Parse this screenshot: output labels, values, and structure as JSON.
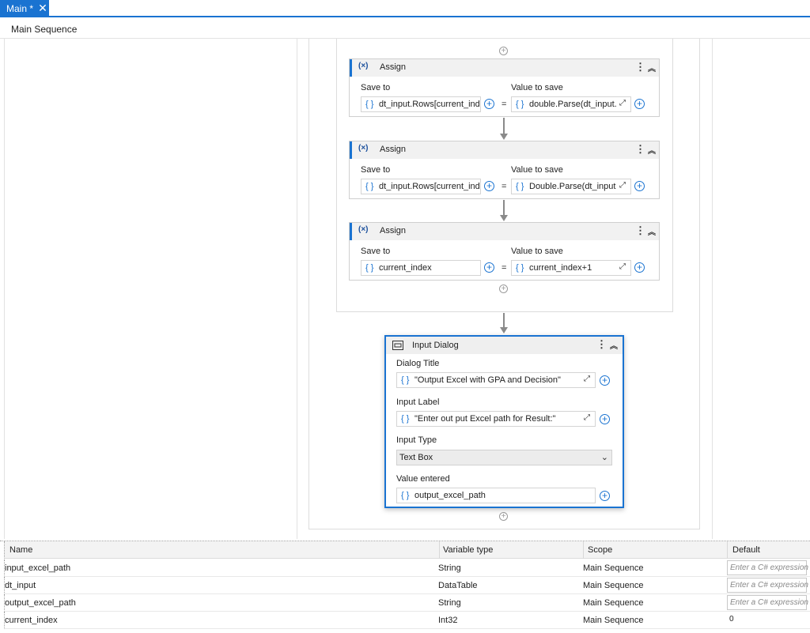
{
  "tab": {
    "label": "Main *",
    "close": "✕"
  },
  "breadcrumb": "Main Sequence",
  "assigns": [
    {
      "title": "Assign",
      "save_to_label": "Save to",
      "value_label": "Value to save",
      "save_to": "dt_input.Rows[current_inde",
      "value": "double.Parse(dt_input."
    },
    {
      "title": "Assign",
      "save_to_label": "Save to",
      "value_label": "Value to save",
      "save_to": "dt_input.Rows[current_inde",
      "value": "Double.Parse(dt_input."
    },
    {
      "title": "Assign",
      "save_to_label": "Save to",
      "value_label": "Value to save",
      "save_to": "current_index",
      "value": "current_index+1"
    }
  ],
  "input_dialog": {
    "title": "Input Dialog",
    "dialog_title_label": "Dialog Title",
    "dialog_title_value": "\"Output Excel with GPA and Decision\"",
    "input_label_label": "Input Label",
    "input_label_value": "\"Enter out put Excel path for Result:\"",
    "input_type_label": "Input Type",
    "input_type_value": "Text Box",
    "value_entered_label": "Value entered",
    "value_entered_value": "output_excel_path"
  },
  "icons": {
    "brace": "{ }",
    "assign": "(×)",
    "kebab": "⋮",
    "collapse": "︽",
    "expand": "⤢",
    "add": "+",
    "chevron_down": "⌄",
    "equals": "="
  },
  "variables": {
    "headers": {
      "name": "Name",
      "type": "Variable type",
      "scope": "Scope",
      "default": "Default"
    },
    "rows": [
      {
        "name": "input_excel_path",
        "type": "String",
        "scope": "Main Sequence",
        "default": "Enter a C# expression"
      },
      {
        "name": "dt_input",
        "type": "DataTable",
        "scope": "Main Sequence",
        "default": "Enter a C# expression"
      },
      {
        "name": "output_excel_path",
        "type": "String",
        "scope": "Main Sequence",
        "default": "Enter a C# expression"
      },
      {
        "name": "current_index",
        "type": "Int32",
        "scope": "Main Sequence",
        "default": "0"
      }
    ]
  },
  "colors": {
    "accent": "#1a73d1",
    "header_bg": "#f1f1f1",
    "border": "#cfcfcf"
  }
}
